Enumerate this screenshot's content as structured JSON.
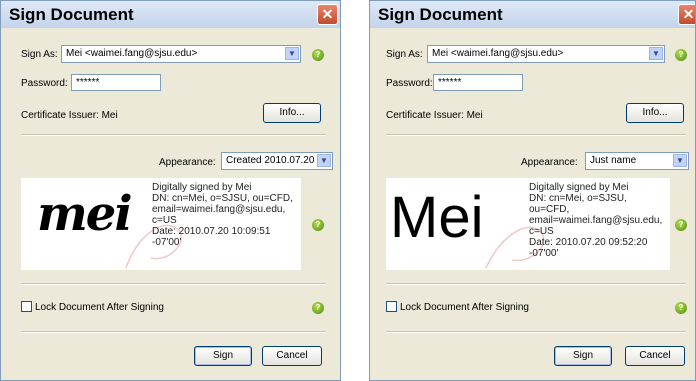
{
  "left": {
    "title": "Sign Document",
    "close_glyph": "✕",
    "sign_as_label": "Sign As:",
    "sign_as_value": "Mei <waimei.fang@sjsu.edu>",
    "password_label": "Password:",
    "password_value": "******",
    "certificate_issuer": "Certificate Issuer: Mei",
    "info_button": "Info...",
    "appearance_label": "Appearance:",
    "appearance_value": "Created 2010.07.20",
    "signature_image_text": "mei",
    "signature_details": "Digitally signed by Mei\nDN: cn=Mei, o=SJSU, ou=CFD,\nemail=waimei.fang@sjsu.edu,\nc=US\nDate: 2010.07.20 10:09:51\n-07'00'",
    "lock_label": "Lock Document After Signing",
    "sign_button": "Sign",
    "cancel_button": "Cancel",
    "help_glyph": "?"
  },
  "right": {
    "title": "Sign Document",
    "close_glyph": "✕",
    "sign_as_label": "Sign As:",
    "sign_as_value": "Mei <waimei.fang@sjsu.edu>",
    "password_label": "Password:",
    "password_value": "******",
    "certificate_issuer": "Certificate Issuer: Mei",
    "info_button": "Info...",
    "appearance_label": "Appearance:",
    "appearance_value": "Just name",
    "signature_name_text": "Mei",
    "signature_details": "Digitally signed by Mei\nDN: cn=Mei, o=SJSU,\nou=CFD,\nemail=waimei.fang@sjsu.edu,\nc=US\nDate: 2010.07.20 09:52:20\n-07'00'",
    "lock_label": "Lock Document After Signing",
    "sign_button": "Sign",
    "cancel_button": "Cancel",
    "help_glyph": "?"
  },
  "colors": {
    "dialog_bg": "#ece9d8",
    "close_button": "#c24b2c",
    "help_icon": "#4a8a10"
  }
}
